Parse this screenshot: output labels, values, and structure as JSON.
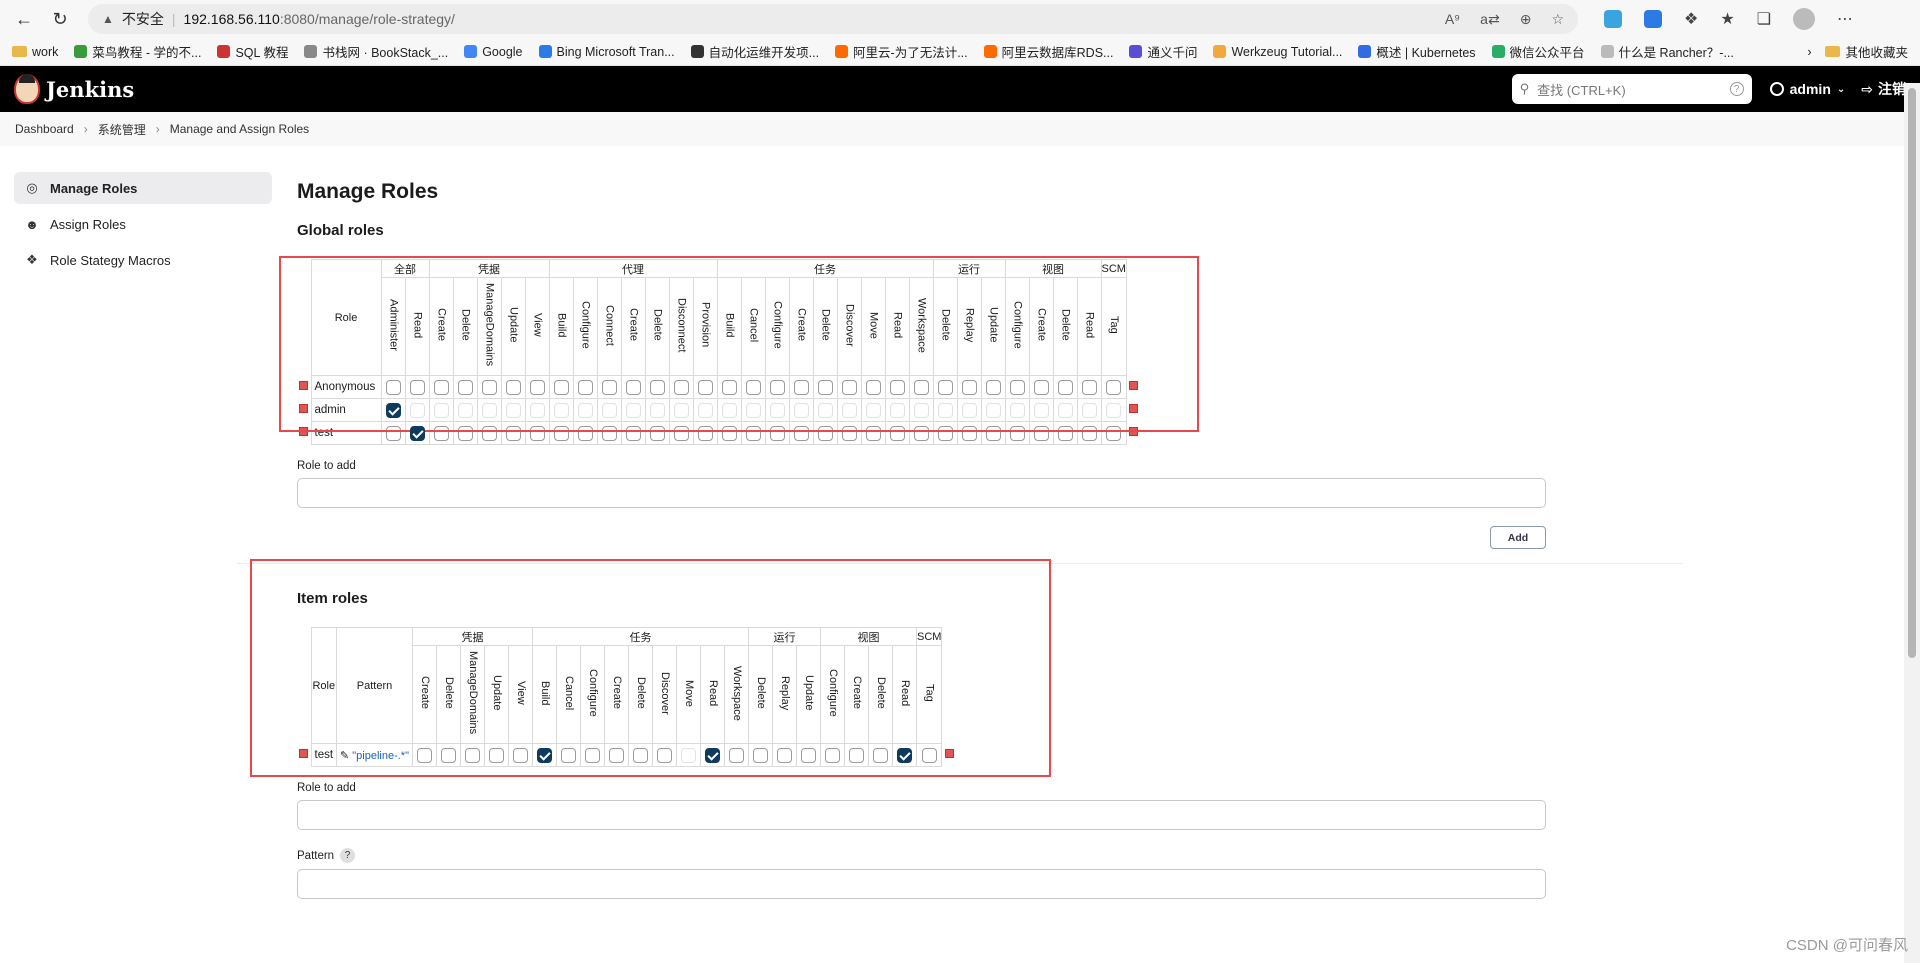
{
  "browser": {
    "security": "不安全",
    "url_host": "192.168.56.110",
    "url_rest": ":8080/manage/role-strategy/",
    "bookmarks": [
      "work",
      "菜鸟教程 - 学的不...",
      "SQL 教程",
      "书栈网 · BookStack_...",
      "Google",
      "Bing Microsoft Tran...",
      "自动化运维开发项...",
      "阿里云-为了无法计...",
      "阿里云数据库RDS...",
      "通义千问",
      "Werkzeug Tutorial...",
      "概述 | Kubernetes",
      "微信公众平台",
      "什么是 Rancher？-..."
    ],
    "other_bookmarks": "其他收藏夹"
  },
  "header": {
    "logo": "Jenkins",
    "search_placeholder": "查找 (CTRL+K)",
    "user": "admin",
    "logout": "注销"
  },
  "breadcrumb": [
    "Dashboard",
    "系统管理",
    "Manage and Assign Roles"
  ],
  "sidebar": {
    "items": [
      {
        "label": "Manage Roles",
        "icon": "fingerprint-icon",
        "active": true
      },
      {
        "label": "Assign Roles",
        "icon": "users-icon",
        "active": false
      },
      {
        "label": "Role Stategy Macros",
        "icon": "puzzle-icon",
        "active": false
      }
    ]
  },
  "page": {
    "title": "Manage Roles",
    "global_title": "Global roles",
    "item_title": "Item roles",
    "role_to_add": "Role to add",
    "add_label": "Add",
    "pattern_label": "Pattern",
    "help": "?"
  },
  "global": {
    "role_header": "Role",
    "groups": [
      {
        "name": "全部",
        "perms": [
          "Administer",
          "Read"
        ]
      },
      {
        "name": "凭据",
        "perms": [
          "Create",
          "Delete",
          "ManageDomains",
          "Update",
          "View"
        ]
      },
      {
        "name": "代理",
        "perms": [
          "Build",
          "Configure",
          "Connect",
          "Create",
          "Delete",
          "Disconnect",
          "Provision"
        ]
      },
      {
        "name": "任务",
        "perms": [
          "Build",
          "Cancel",
          "Configure",
          "Create",
          "Delete",
          "Discover",
          "Move",
          "Read",
          "Workspace"
        ]
      },
      {
        "name": "运行",
        "perms": [
          "Delete",
          "Replay",
          "Update"
        ]
      },
      {
        "name": "视图",
        "perms": [
          "Configure",
          "Create",
          "Delete",
          "Read"
        ]
      },
      {
        "name": "SCM",
        "perms": [
          "Tag"
        ]
      }
    ],
    "rows": [
      {
        "name": "Anonymous",
        "checked": [],
        "disabled_rest": false
      },
      {
        "name": "admin",
        "checked": [
          0
        ],
        "disabled_rest": true
      },
      {
        "name": "test",
        "checked": [
          1
        ],
        "disabled_rest": false
      }
    ]
  },
  "item": {
    "role_header": "Role",
    "pattern_header": "Pattern",
    "groups": [
      {
        "name": "凭据",
        "perms": [
          "Create",
          "Delete",
          "ManageDomains",
          "Update",
          "View"
        ]
      },
      {
        "name": "任务",
        "perms": [
          "Build",
          "Cancel",
          "Configure",
          "Create",
          "Delete",
          "Discover",
          "Move",
          "Read",
          "Workspace"
        ]
      },
      {
        "name": "运行",
        "perms": [
          "Delete",
          "Replay",
          "Update"
        ]
      },
      {
        "name": "视图",
        "perms": [
          "Configure",
          "Create",
          "Delete",
          "Read"
        ]
      },
      {
        "name": "SCM",
        "perms": [
          "Tag"
        ]
      }
    ],
    "rows": [
      {
        "name": "test",
        "pattern": "\"pipeline-.*\"",
        "checked": [
          5,
          12,
          20
        ],
        "disabled": [
          11
        ]
      }
    ]
  },
  "watermark": "CSDN @可问春风"
}
